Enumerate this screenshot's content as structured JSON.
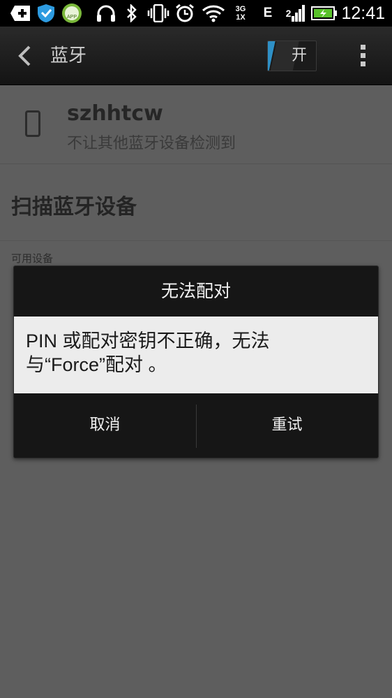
{
  "status_bar": {
    "icons": [
      "add-icon",
      "shield-icon",
      "app-icon",
      "headphones-icon",
      "bluetooth-icon",
      "vibrate-icon",
      "alarm-icon",
      "wifi-icon",
      "network-3g-1x-icon",
      "edge-icon",
      "signal-icon",
      "battery-charging-icon"
    ],
    "app_badge": "APP",
    "net_3g": "3G",
    "net_1x": "1X",
    "edge": "E",
    "signal_digit": "2",
    "time": "12:41"
  },
  "action_bar": {
    "title": "蓝牙",
    "toggle_label": "开",
    "toggle_accent": "#2e90c6"
  },
  "device": {
    "name": "szhhtcw",
    "visibility": "不让其他蓝牙设备检测到"
  },
  "scan": {
    "label": "扫描蓝牙设备"
  },
  "available_section": {
    "header": "可用设备"
  },
  "dialog": {
    "title": "无法配对",
    "message_line1": "PIN 或配对密钥不正确，无法",
    "message_line2": "与“Force”配对 。",
    "cancel_label": "取消",
    "retry_label": "重试"
  }
}
